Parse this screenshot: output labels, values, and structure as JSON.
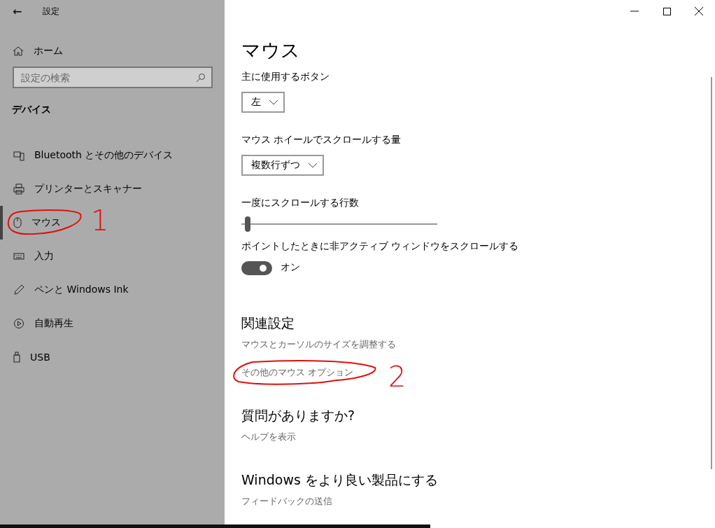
{
  "window": {
    "title": "設定",
    "back": "←"
  },
  "sidebar": {
    "home": "ホーム",
    "search": {
      "placeholder": "設定の検索"
    },
    "section": "デバイス",
    "items": [
      {
        "label": "Bluetooth とその他のデバイス",
        "selected": false
      },
      {
        "label": "プリンターとスキャナー",
        "selected": false
      },
      {
        "label": "マウス",
        "selected": true,
        "annotation": "1"
      },
      {
        "label": "入力",
        "selected": false
      },
      {
        "label": "ペンと Windows Ink",
        "selected": false
      },
      {
        "label": "自動再生",
        "selected": false
      },
      {
        "label": "USB",
        "selected": false
      }
    ]
  },
  "content": {
    "title": "マウス",
    "settings": [
      {
        "kind": "dropdown",
        "label": "主に使用するボタン",
        "value": "左"
      },
      {
        "kind": "dropdown",
        "label": "マウス ホイールでスクロールする量",
        "value": "複数行ずつ"
      },
      {
        "kind": "slider",
        "label": "一度にスクロールする行数",
        "level": 0.02
      },
      {
        "kind": "toggle",
        "label": "ポイントしたときに非アクティブ ウィンドウをスクロールする",
        "on": true,
        "state_text": "オン"
      }
    ],
    "sections": [
      {
        "heading": "関連設定",
        "links": [
          {
            "label": "マウスとカーソルのサイズを調整する"
          },
          {
            "label": "その他のマウス オプション",
            "annotation": "2"
          }
        ]
      },
      {
        "heading": "質問がありますか?",
        "links": [
          {
            "label": "ヘルプを表示"
          }
        ]
      },
      {
        "heading": "Windows をより良い製品にする",
        "links": [
          {
            "label": "フィードバックの送信"
          }
        ]
      }
    ]
  }
}
